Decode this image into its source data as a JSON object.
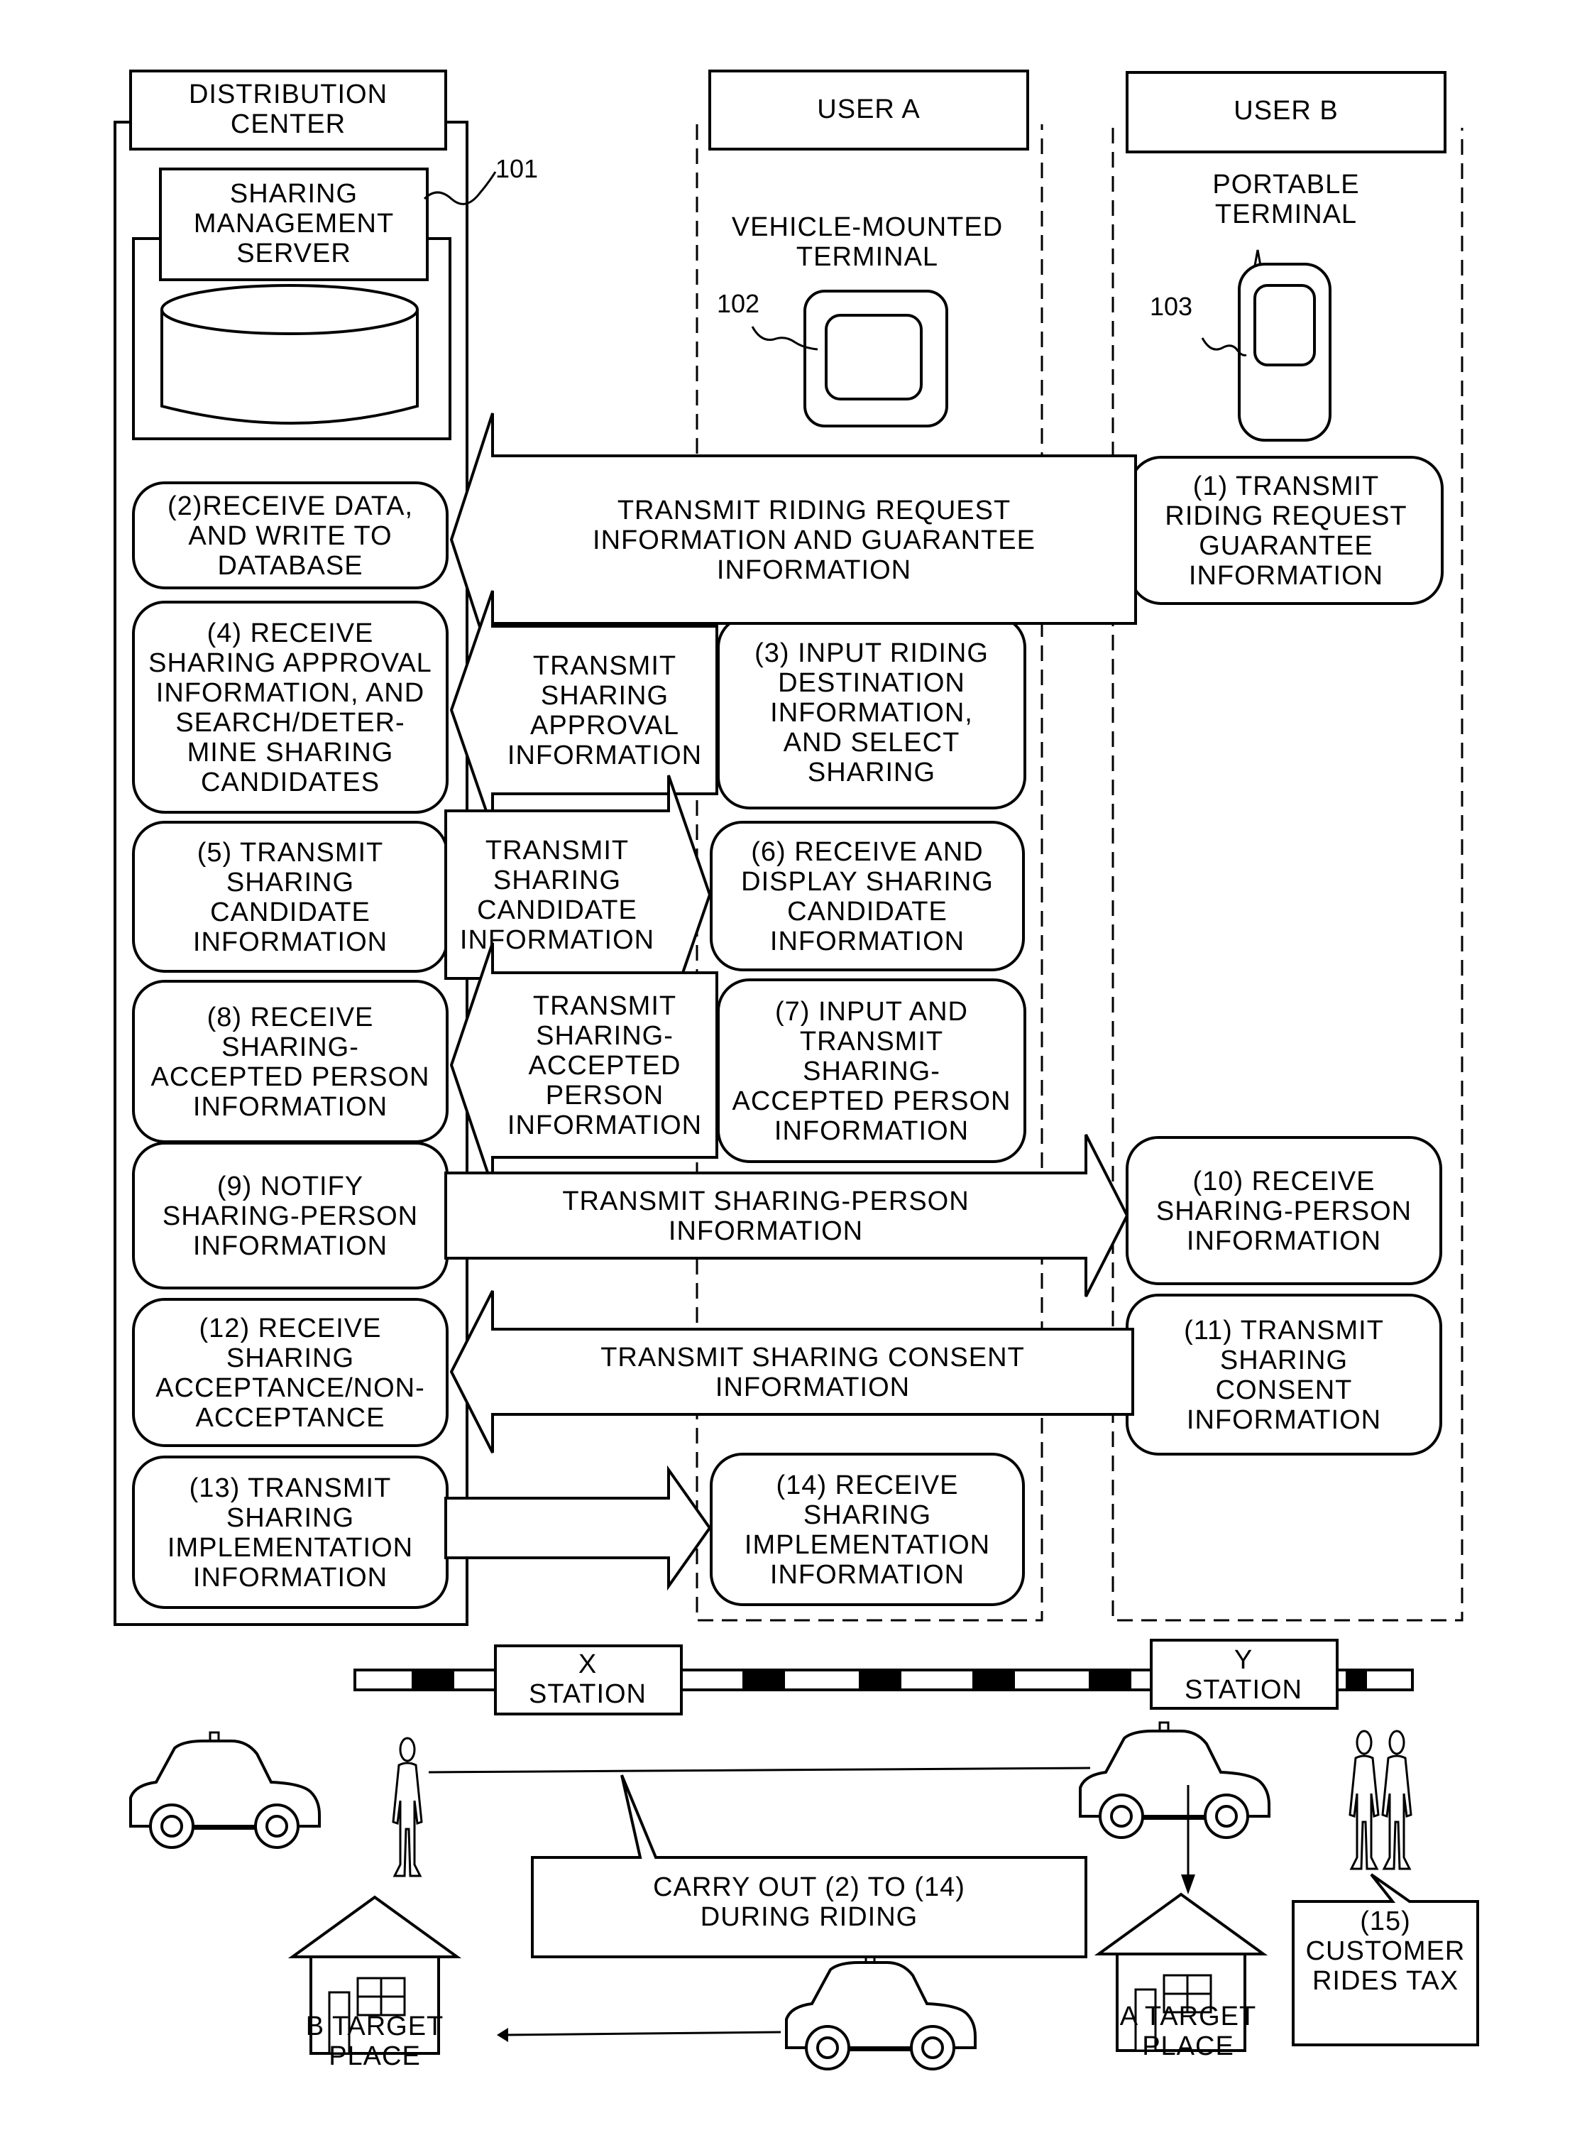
{
  "lanes": {
    "distribution_center": "DISTRIBUTION\nCENTER",
    "user_a": "USER A",
    "user_b": "USER B"
  },
  "devices": {
    "server": {
      "label": "SHARING\nMANAGEMENT\nSERVER",
      "ref": "101"
    },
    "vehicle_terminal": {
      "label": "VEHICLE-MOUNTED\nTERMINAL",
      "ref": "102"
    },
    "portable_terminal": {
      "label": "PORTABLE\nTERMINAL",
      "ref": "103"
    }
  },
  "steps": {
    "s1": "(1) TRANSMIT\nRIDING REQUEST\nGUARANTEE\nINFORMATION",
    "s2": "(2)RECEIVE DATA,\nAND WRITE TO\nDATABASE",
    "s3": "(3) INPUT RIDING\nDESTINATION\nINFORMATION,\nAND SELECT\nSHARING",
    "s4": "(4) RECEIVE\nSHARING APPROVAL\nINFORMATION, AND\nSEARCH/DETER-\nMINE SHARING\nCANDIDATES",
    "s5": "(5) TRANSMIT\nSHARING\nCANDIDATE\nINFORMATION",
    "s6": "(6) RECEIVE AND\nDISPLAY SHARING\nCANDIDATE\nINFORMATION",
    "s7": "(7) INPUT AND\nTRANSMIT\nSHARING-\nACCEPTED PERSON\nINFORMATION",
    "s8": "(8) RECEIVE\nSHARING-\nACCEPTED PERSON\nINFORMATION",
    "s9": "(9) NOTIFY\nSHARING-PERSON\nINFORMATION",
    "s10": "(10) RECEIVE\nSHARING-PERSON\nINFORMATION",
    "s11": "(11) TRANSMIT\nSHARING\nCONSENT\nINFORMATION",
    "s12": "(12) RECEIVE\nSHARING\nACCEPTANCE/NON-\nACCEPTANCE",
    "s13": "(13) TRANSMIT\nSHARING\nIMPLEMENTATION\nINFORMATION",
    "s14": "(14) RECEIVE\nSHARING\nIMPLEMENTATION\nINFORMATION"
  },
  "arrows": {
    "a1": "TRANSMIT RIDING REQUEST\nINFORMATION AND GUARANTEE\nINFORMATION",
    "a3": "TRANSMIT\nSHARING\nAPPROVAL\nINFORMATION",
    "a5": "TRANSMIT\nSHARING\nCANDIDATE\nINFORMATION",
    "a7": "TRANSMIT\nSHARING-\nACCEPTED\nPERSON\nINFORMATION",
    "a9": "TRANSMIT SHARING-PERSON\nINFORMATION",
    "a11": "TRANSMIT SHARING CONSENT\nINFORMATION",
    "a13": ""
  },
  "scene": {
    "x_station": "X\nSTATION",
    "y_station": "Y\nSTATION",
    "callout_riding": "CARRY OUT (2) TO (14)\nDURING RIDING",
    "callout_customer": "(15)\nCUSTOMER\nRIDES TAX",
    "b_target": "B TARGET\nPLACE",
    "a_target": "A TARGET\nPLACE"
  }
}
